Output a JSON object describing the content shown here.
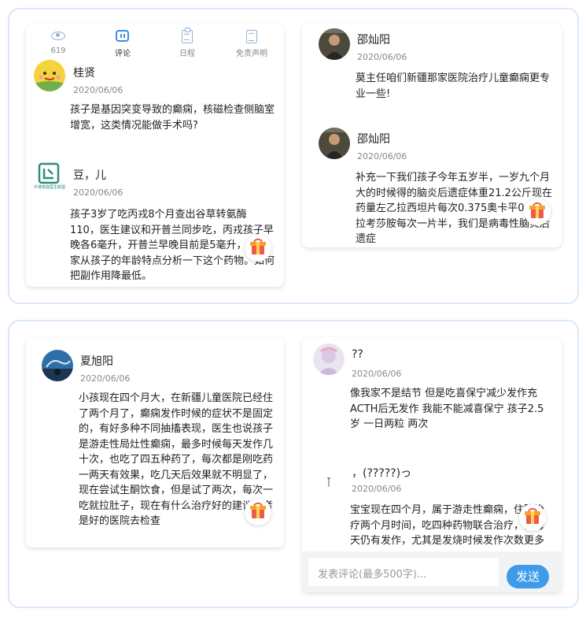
{
  "tabs": [
    {
      "label": "619",
      "icon": "eye-icon"
    },
    {
      "label": "评论",
      "icon": "comment-icon"
    },
    {
      "label": "日程",
      "icon": "clipboard-icon"
    },
    {
      "label": "免责声明",
      "icon": "document-icon"
    }
  ],
  "top_left_comments": [
    {
      "name": "桂贤",
      "date": "2020/06/06",
      "text": "孩子是基因突变导致的癫痫，核磁检查侧脑室增宽，这类情况能做手术吗?"
    },
    {
      "name": "豆，儿",
      "date": "2020/06/06",
      "avatar_caption": "中港家庭医生联盟",
      "text": "孩子3岁了吃丙戎8个月查出谷草转氨酶110，医生建议和开普兰同步吃，丙戎孩子早晚各6毫升，开普兰早晚目前是5毫升，请专家从孩子的年龄特点分析一下这个药物。如何把副作用降最低。"
    }
  ],
  "top_right_comments": [
    {
      "name": "邵灿阳",
      "date": "2020/06/06",
      "text": "莫主任咱们新疆那家医院治疗儿童癫痫更专业一些!"
    },
    {
      "name": "邵灿阳",
      "date": "2020/06/06",
      "text": "补充一下我们孩子今年五岁半，一岁九个月大的时候得的脑炎后遗症体重21.2公斤现在药量左乙拉西坦片每次0.375奥卡平0.225拉考莎胺每次一片半，我们是病毒性脑炎后遗症"
    }
  ],
  "bottom_left_comments": [
    {
      "name": "夏旭阳",
      "date": "2020/06/06",
      "text": "小孩现在四个月大，在新疆儿童医院已经住了两个月了，癫痫发作时候的症状不是固定的，有好多种不同抽搐表现，医生也说孩子是游走性局灶性癫痫，最多时候每天发作几十次，也吃了四五种药了，每次都是刚吃药一两天有效果，吃几天后效果就不明显了，现在尝试生酮饮食，但是试了两次，每次一吃就拉肚子，现在有什么治疗好的建议或者是好的医院去检查"
    }
  ],
  "bottom_right_comments": [
    {
      "name": "??",
      "date": "2020/06/06",
      "text": "像我家不是结节 但是吃喜保宁减少发作充ACTH后无发作 我能不能减喜保宁 孩子2.5岁 一日两粒 两次"
    },
    {
      "name": "，(?????)っ",
      "date": "2020/06/06",
      "text": "宝宝现在四个月，属于游走性癫痫，住院治疗两个月时间，吃四种药物联合治疗，但每天仍有发作，尤其是发烧时候发作次数更多"
    }
  ],
  "comment_input": {
    "placeholder": "发表评论(最多500字)...",
    "send_label": "发送"
  },
  "colors": {
    "accent": "#3d9bea",
    "panel_border": "#dbe9fb",
    "gift_red": "#f15a4a",
    "gift_orange": "#f7a22b"
  }
}
